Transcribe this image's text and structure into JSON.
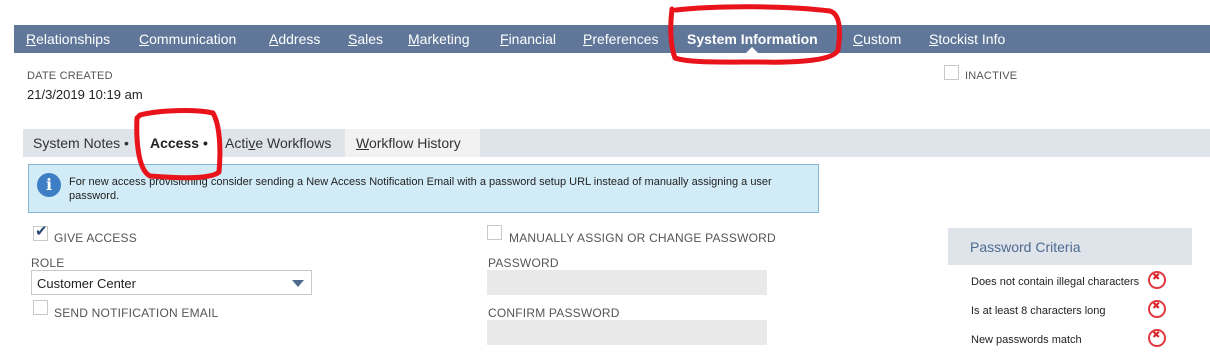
{
  "top_tabs": [
    {
      "hk": "R",
      "rest": "elationships"
    },
    {
      "hk": "C",
      "rest": "ommunication"
    },
    {
      "hk": "A",
      "rest": "ddress"
    },
    {
      "hk": "S",
      "rest": "ales"
    },
    {
      "hk": "M",
      "rest": "arketing"
    },
    {
      "hk": "F",
      "rest": "inancial"
    },
    {
      "hk": "P",
      "rest": "references"
    },
    {
      "label": "System Information"
    },
    {
      "hk": "C",
      "rest": "ustom"
    },
    {
      "hk": "S",
      "rest": "tockist Info"
    }
  ],
  "date_created": {
    "label": "DATE CREATED",
    "value": "21/3/2019 10:19 am"
  },
  "inactive": {
    "label": "INACTIVE",
    "checked": false
  },
  "sub_tabs": {
    "system_notes": "System Notes",
    "access": "Access",
    "dot": "•",
    "active_workflows": {
      "pre": "Acti",
      "hk": "v",
      "post": "e Workflows"
    },
    "workflow_history": {
      "hk": "W",
      "rest": "orkflow History"
    }
  },
  "info": {
    "icon": "info-icon",
    "text": "For new access provisioning consider sending a New Access Notification Email with a password setup URL instead of manually assigning a user password."
  },
  "form": {
    "give_access": {
      "label": "GIVE ACCESS",
      "checked": true
    },
    "role": {
      "label": "ROLE",
      "value": "Customer Center"
    },
    "send_notification": {
      "label": "SEND NOTIFICATION EMAIL",
      "checked": false
    },
    "manually_assign": {
      "label": "MANUALLY ASSIGN OR CHANGE PASSWORD",
      "checked": false
    },
    "password_label": "PASSWORD",
    "confirm_password_label": "CONFIRM PASSWORD"
  },
  "password_criteria": {
    "title": "Password Criteria",
    "items": [
      "Does not contain illegal characters",
      "Is at least 8 characters long",
      "New passwords match"
    ],
    "status_icon": "x-circle-icon",
    "status_color": "#e0393f"
  },
  "colors": {
    "tab_bar": "#607799",
    "annotation": "#e8131b"
  }
}
